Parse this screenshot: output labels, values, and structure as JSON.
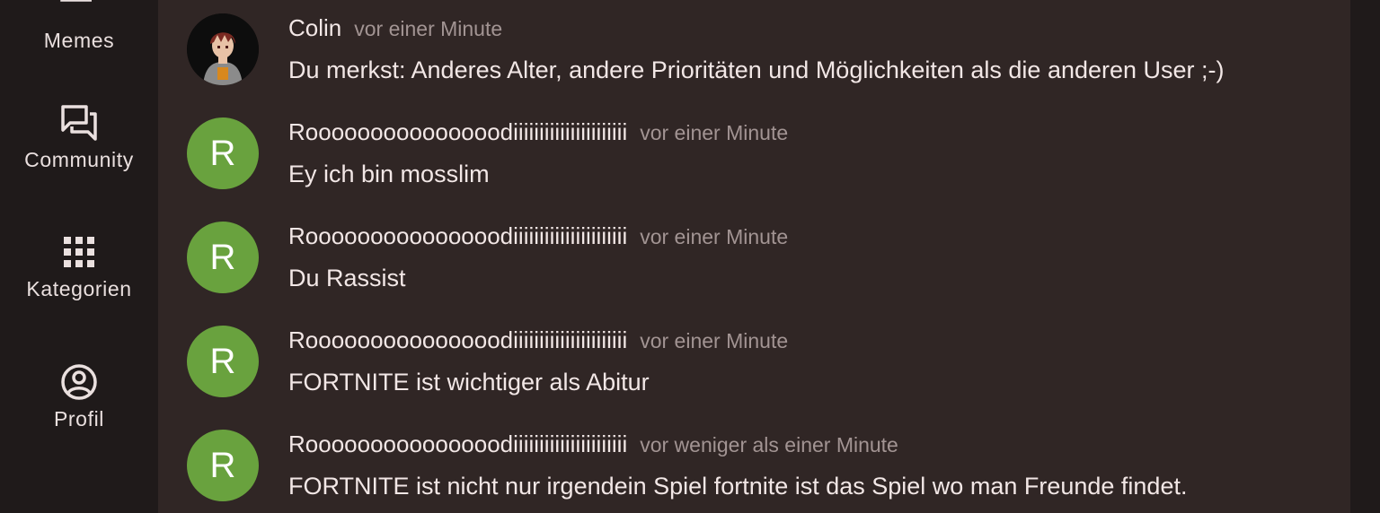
{
  "nav": {
    "items": [
      {
        "label": "Memes",
        "icon": "memes-stack-icon"
      },
      {
        "label": "Community",
        "icon": "chat-bubbles-icon"
      },
      {
        "label": "Kategorien",
        "icon": "grid-icon"
      },
      {
        "label": "Profil",
        "icon": "profile-circle-icon"
      }
    ]
  },
  "messages": [
    {
      "author": "Colin",
      "time": "vor einer Minute",
      "avatar": "profile-picture",
      "text": "Du merkst: Anderes Alter, andere Prioritäten und Möglichkeiten als die anderen User ;-)"
    },
    {
      "author": "Rooooooooooooooodiiiiiiiiiiiiiiiiiiiiii",
      "time": "vor einer Minute",
      "avatar_letter": "R",
      "text": "Ey ich bin mosslim"
    },
    {
      "author": "Rooooooooooooooodiiiiiiiiiiiiiiiiiiiiii",
      "time": "vor einer Minute",
      "avatar_letter": "R",
      "text": "Du Rassist"
    },
    {
      "author": "Rooooooooooooooodiiiiiiiiiiiiiiiiiiiiii",
      "time": "vor einer Minute",
      "avatar_letter": "R",
      "text": "FORTNITE ist wichtiger als Abitur"
    },
    {
      "author": "Rooooooooooooooodiiiiiiiiiiiiiiiiiiiiii",
      "time": "vor weniger als einer Minute",
      "avatar_letter": "R",
      "text": "FORTNITE ist nicht nur irgendein Spiel fortnite ist das Spiel wo man Freunde findet."
    }
  ],
  "colors": {
    "sidebar_bg": "#1f1a1a",
    "panel_bg": "#302625",
    "avatar_green": "#69a23e",
    "text": "#f2e7e6",
    "muted": "#a29493"
  }
}
